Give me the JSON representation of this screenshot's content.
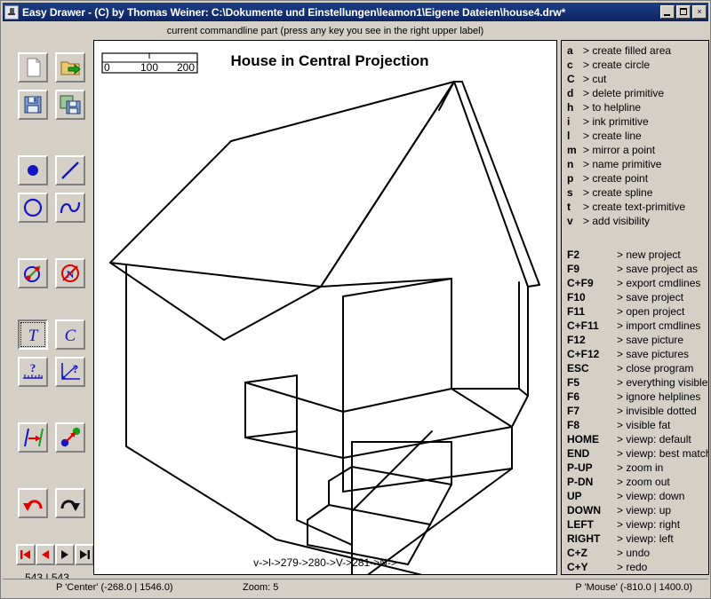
{
  "window": {
    "title": "Easy Drawer - (C) by Thomas Weiner: C:\\Dokumente und Einstellungen\\leamon1\\Eigene Dateien\\house4.drw*",
    "minimize_label": "_",
    "maximize_label": "",
    "close_label": "×"
  },
  "toolbar": {
    "buttons": [
      {
        "name": "new-file-button",
        "icon": "new-file-icon"
      },
      {
        "name": "open-file-button",
        "icon": "open-folder-icon"
      },
      {
        "name": "save-button",
        "icon": "floppy-save-icon"
      },
      {
        "name": "save-as-button",
        "icon": "floppy-save-as-icon"
      },
      {
        "name": "create-point-button",
        "icon": "point-icon"
      },
      {
        "name": "create-line-button",
        "icon": "line-icon"
      },
      {
        "name": "create-circle-button",
        "icon": "circle-icon"
      },
      {
        "name": "create-spline-button",
        "icon": "spline-icon"
      },
      {
        "name": "mirror-point-button",
        "icon": "mirror-icon"
      },
      {
        "name": "name-primitive-button",
        "icon": "no-name-icon"
      },
      {
        "name": "create-text-button",
        "icon": "text-t-icon"
      },
      {
        "name": "cut-button",
        "icon": "cut-c-icon"
      },
      {
        "name": "measure-distance-button",
        "icon": "ruler-question-icon"
      },
      {
        "name": "measure-angle-button",
        "icon": "angle-question-icon"
      },
      {
        "name": "visibility-button",
        "icon": "visibility-arrow-icon"
      },
      {
        "name": "connect-points-button",
        "icon": "connect-points-icon"
      },
      {
        "name": "undo-button",
        "icon": "undo-arrow-icon"
      },
      {
        "name": "redo-button",
        "icon": "redo-arrow-icon"
      }
    ],
    "nav": [
      {
        "name": "nav-first-button",
        "icon": "skip-back-icon"
      },
      {
        "name": "nav-prev-button",
        "icon": "step-back-icon"
      },
      {
        "name": "nav-next-button",
        "icon": "step-forward-icon"
      },
      {
        "name": "nav-last-button",
        "icon": "skip-forward-icon"
      }
    ],
    "counter": "543 | 543"
  },
  "canvas": {
    "header_label": "current commandline part (press any key you see in the right upper label)",
    "drawing_title": "House in Central Projection",
    "scale_labels": [
      "0",
      "100",
      "200"
    ],
    "commandline": "v->l->279->280->V->281->N->"
  },
  "help": {
    "key_commands": [
      {
        "key": "a",
        "desc": "> create filled area"
      },
      {
        "key": "c",
        "desc": "> create circle"
      },
      {
        "key": "C",
        "desc": "> cut"
      },
      {
        "key": "d",
        "desc": "> delete primitive"
      },
      {
        "key": "h",
        "desc": "> to helpline"
      },
      {
        "key": "i",
        "desc": "> ink primitive"
      },
      {
        "key": "l",
        "desc": "> create line"
      },
      {
        "key": "m",
        "desc": "> mirror a point"
      },
      {
        "key": "n",
        "desc": "> name primitive"
      },
      {
        "key": "p",
        "desc": "> create point"
      },
      {
        "key": "s",
        "desc": "> create spline"
      },
      {
        "key": "t",
        "desc": "> create text-primitive"
      },
      {
        "key": "v",
        "desc": "> add visibility"
      }
    ],
    "function_commands": [
      {
        "key": "F2",
        "desc": "> new project"
      },
      {
        "key": "F9",
        "desc": "> save project as"
      },
      {
        "key": "C+F9",
        "desc": "> export cmdlines"
      },
      {
        "key": "F10",
        "desc": "> save project"
      },
      {
        "key": "F11",
        "desc": "> open project"
      },
      {
        "key": "C+F11",
        "desc": "> import cmdlines"
      },
      {
        "key": "F12",
        "desc": "> save picture"
      },
      {
        "key": "C+F12",
        "desc": "> save pictures"
      },
      {
        "key": "ESC",
        "desc": "> close program"
      },
      {
        "key": "F5",
        "desc": "> everything visible"
      },
      {
        "key": "F6",
        "desc": "> ignore helplines"
      },
      {
        "key": "F7",
        "desc": "> invisible dotted"
      },
      {
        "key": "F8",
        "desc": "> visible fat"
      },
      {
        "key": "HOME",
        "desc": "> viewp: default"
      },
      {
        "key": "END",
        "desc": "> viewp: best match"
      },
      {
        "key": "P-UP",
        "desc": "> zoom in"
      },
      {
        "key": "P-DN",
        "desc": "> zoom out"
      },
      {
        "key": "UP",
        "desc": "> viewp: down"
      },
      {
        "key": "DOWN",
        "desc": "> viewp: up"
      },
      {
        "key": "LEFT",
        "desc": "> viewp: right"
      },
      {
        "key": "RIGHT",
        "desc": "> viewp: left"
      },
      {
        "key": "C+Z",
        "desc": "> undo"
      },
      {
        "key": "C+Y",
        "desc": "> redo"
      }
    ]
  },
  "status": {
    "center_point": "P 'Center' (-268.0 | 1546.0)",
    "zoom": "Zoom: 5",
    "mouse_point": "P 'Mouse' (-810.0 | 1400.0)"
  },
  "colors": {
    "titlebar": "#0d2461",
    "chrome": "#d4d0c8",
    "canvas": "#ffffff",
    "primitive_blue": "#1414c8",
    "accent_red": "#e00000",
    "accent_green": "#00a000"
  }
}
